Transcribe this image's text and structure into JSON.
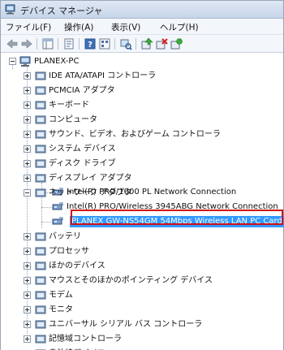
{
  "window": {
    "title": "デバイス マネージャ"
  },
  "menu": [
    "ファイル(F)",
    "操作(A)",
    "表示(V)",
    "ヘルプ(H)"
  ],
  "toolbar": {
    "buttons": [
      "back-icon",
      "forward-icon",
      "show-tree-icon",
      "properties-icon",
      "help-icon",
      "view-icon",
      "scan-hardware-icon",
      "update-driver-icon",
      "uninstall-icon",
      "enable-icon"
    ]
  },
  "tree": {
    "root": "PLANEX-PC",
    "items": [
      {
        "label": "IDE ATA/ATAPI コントローラ",
        "icon": "ide-controller-icon"
      },
      {
        "label": "PCMCIA アダプタ",
        "icon": "pcmcia-icon"
      },
      {
        "label": "キーボード",
        "icon": "keyboard-icon"
      },
      {
        "label": "コンピュータ",
        "icon": "computer-icon"
      },
      {
        "label": "サウンド、ビデオ、およびゲーム コントローラ",
        "icon": "sound-icon"
      },
      {
        "label": "システム デバイス",
        "icon": "system-device-icon"
      },
      {
        "label": "ディスク ドライブ",
        "icon": "disk-drive-icon"
      },
      {
        "label": "ディスプレイ アダプタ",
        "icon": "display-adapter-icon"
      },
      {
        "label": "ネットワーク アダプタ",
        "icon": "network-adapter-icon"
      },
      {
        "label": "バッテリ",
        "icon": "battery-icon"
      },
      {
        "label": "プロセッサ",
        "icon": "processor-icon"
      },
      {
        "label": "ほかのデバイス",
        "icon": "other-device-icon"
      },
      {
        "label": "マウスとそのほかのポインティング デバイス",
        "icon": "mouse-icon"
      },
      {
        "label": "モデム",
        "icon": "modem-icon"
      },
      {
        "label": "モニタ",
        "icon": "monitor-icon"
      },
      {
        "label": "ユニバーサル シリアル バス コントローラ",
        "icon": "usb-icon"
      },
      {
        "label": "記憶域コントローラ",
        "icon": "storage-controller-icon"
      },
      {
        "label": "赤外線デバイス",
        "icon": "infrared-icon"
      }
    ],
    "network_children": [
      {
        "label": "Intel(R) PRO/1000 PL Network Connection"
      },
      {
        "label": "Intel(R) PRO/Wireless 3945ABG Network Connection"
      },
      {
        "label": "PLANEX GW-NS54GM 54Mbps Wireless LAN PC Card",
        "selected": true
      }
    ]
  },
  "colors": {
    "selection": "#3399ff",
    "highlight_border": "#d10f14"
  }
}
